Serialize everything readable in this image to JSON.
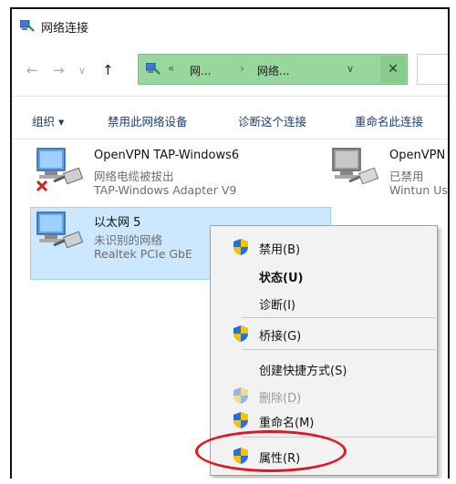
{
  "window": {
    "title": "网络连接"
  },
  "address": {
    "sep1": "«",
    "crumb1": "网...",
    "sep2": "›",
    "crumb2": "网络...",
    "dropdown": "∨",
    "clear": "✕"
  },
  "nav": {
    "back": "←",
    "forward": "→",
    "recent": "∨",
    "up": "↑"
  },
  "toolbar": {
    "organize": "组织 ▾",
    "disable_device": "禁用此网络设备",
    "diagnose": "诊断这个连接",
    "rename": "重命名此连接"
  },
  "connections": [
    {
      "name": "OpenVPN TAP-Windows6",
      "status": "网络电缆被拔出",
      "device": "TAP-Windows Adapter V9"
    },
    {
      "name": "OpenVPN",
      "status": "已禁用",
      "device": "Wintun Us"
    },
    {
      "name": "以太网 5",
      "status": "未识别的网络",
      "device": "Realtek PCIe GbE"
    }
  ],
  "context_menu": {
    "disable": "禁用(B)",
    "status": "状态(U)",
    "diagnose": "诊断(I)",
    "bridge": "桥接(G)",
    "create_shortcut": "创建快捷方式(S)",
    "delete": "删除(D)",
    "rename": "重命名(M)",
    "properties": "属性(R)"
  },
  "colors": {
    "address_bar": "#97d79d",
    "selection": "#cce8ff",
    "highlight_oval": "#e0181f",
    "shield_blue": "#2a6fd6",
    "shield_yellow": "#f5c400"
  }
}
